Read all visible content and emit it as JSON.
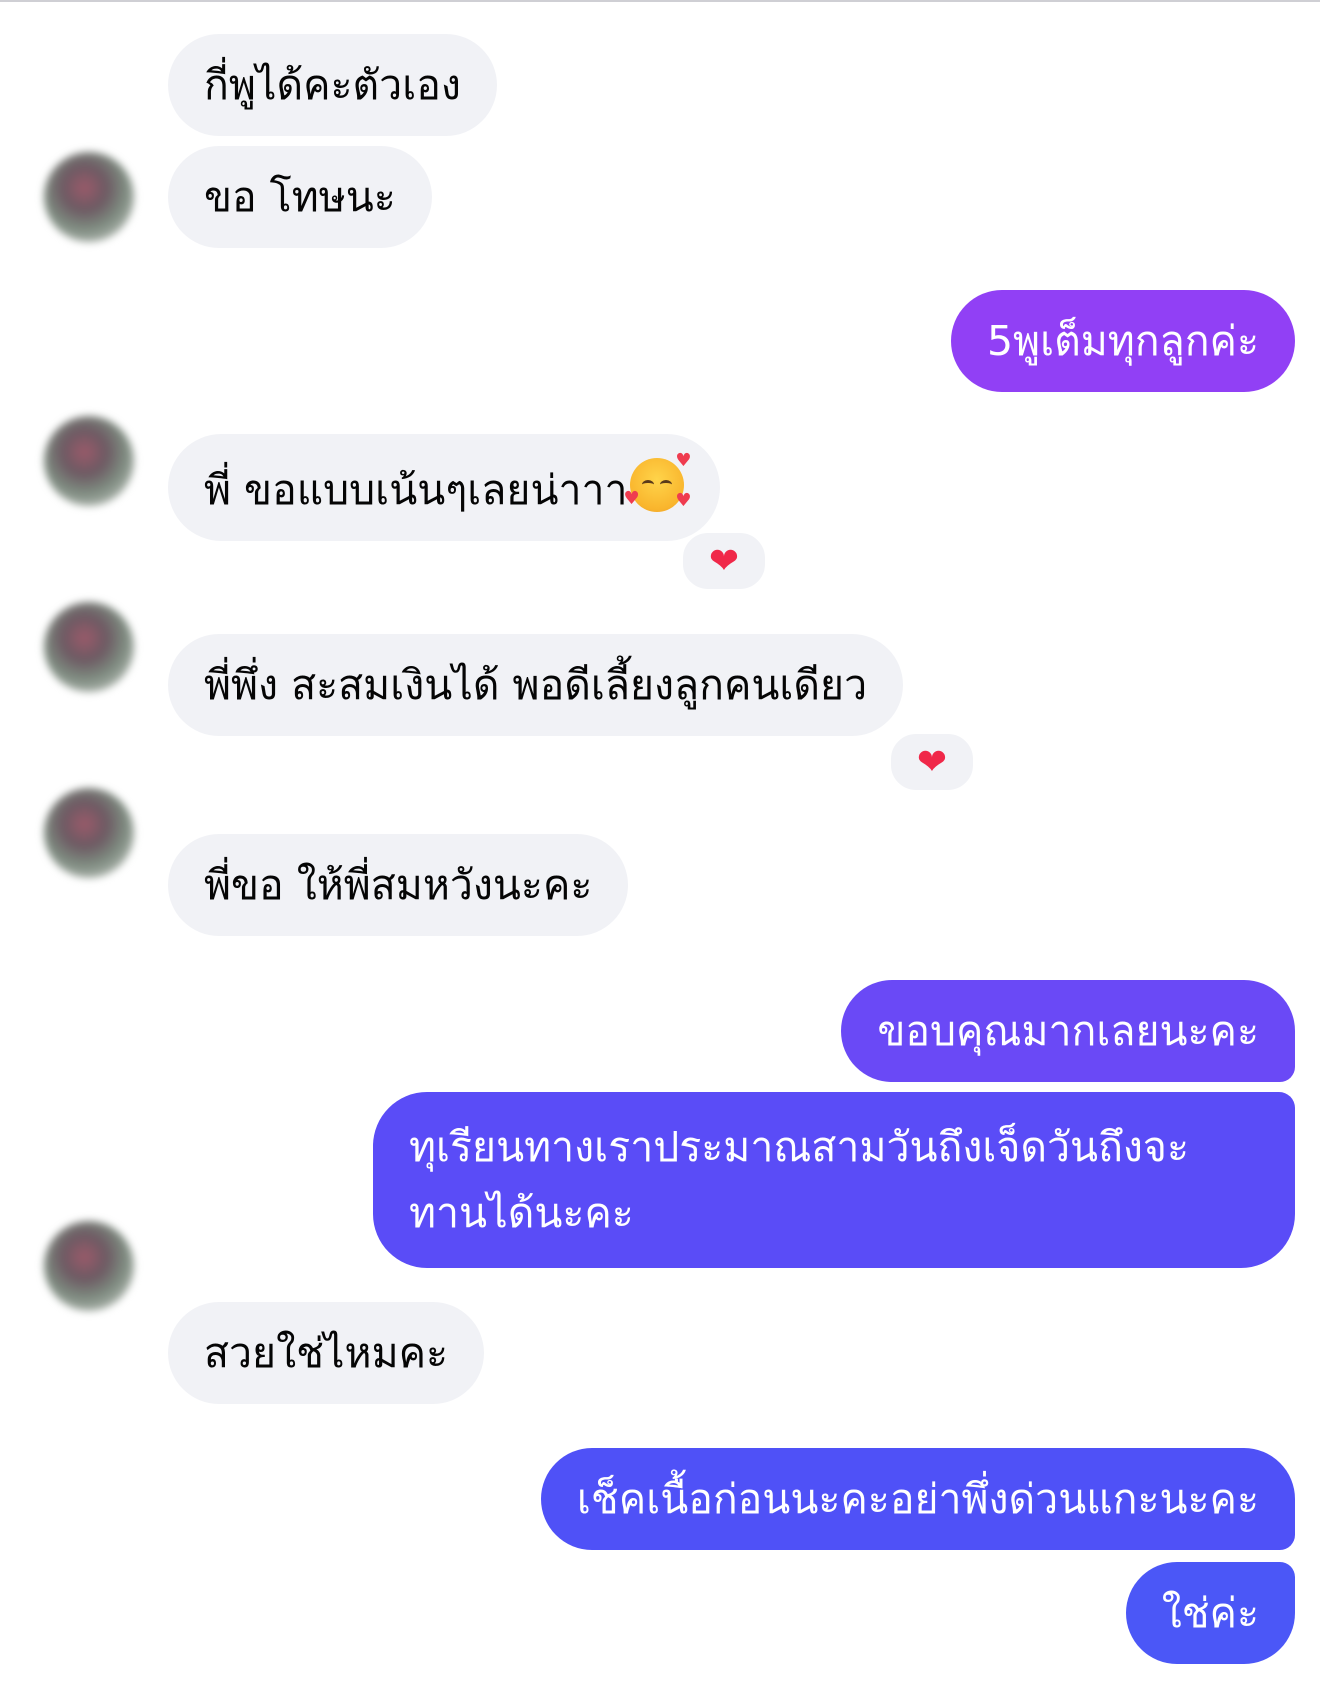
{
  "conversation": {
    "messages": [
      {
        "side": "in",
        "text": "กี่พูได้คะตัวเอง"
      },
      {
        "side": "in",
        "text": "ขอ โทษนะ"
      },
      {
        "side": "out",
        "text": "5พูเต็มทุกลูกค่ะ"
      },
      {
        "side": "in",
        "text": "พี่ ขอแบบเน้นๆเลยน่าาา",
        "emoji": "smiling-face-with-hearts",
        "reaction": "❤"
      },
      {
        "side": "in",
        "text": "พี่พึ่ง สะสมเงินได้ พอดีเลี้ยงลูกคนเดียว",
        "reaction": "❤"
      },
      {
        "side": "in",
        "text": "พี่ขอ ให้พี่สมหวังนะคะ"
      },
      {
        "side": "out",
        "text": "ขอบคุณมากเลยนะคะ"
      },
      {
        "side": "out",
        "text": "ทุเรียนทางเราประมาณสามวันถึงเจ็ดวันถึงจะทานได้นะคะ"
      },
      {
        "side": "in",
        "text": "สวยใช่ไหมคะ"
      },
      {
        "side": "out",
        "text": "เช็คเนื้อก่อนนะคะอย่าพึ่งด่วนแกะนะคะ"
      },
      {
        "side": "out",
        "text": "ใช่ค่ะ"
      }
    ]
  },
  "colors": {
    "incoming_bubble": "#f1f2f6",
    "incoming_text": "#050505",
    "outgoing_gradient": [
      "#9b3ef5",
      "#4b5cf7"
    ],
    "reaction_heart": "#f02849"
  }
}
